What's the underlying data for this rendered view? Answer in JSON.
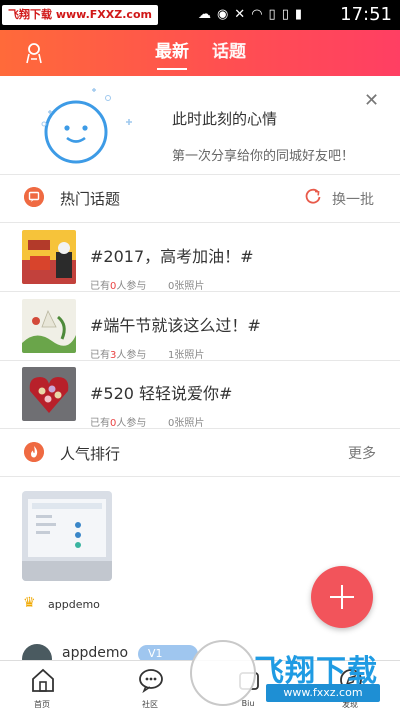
{
  "status_bar": {
    "watermark": "飞翔下载 www.FXXZ.com",
    "time": "17:51",
    "icons": [
      "cloud-icon",
      "eye-icon",
      "mute-icon",
      "wifi-icon",
      "sim-icon",
      "sim2-icon",
      "battery-icon"
    ]
  },
  "header": {
    "tabs": [
      {
        "label": "最新",
        "active": true
      },
      {
        "label": "话题",
        "active": false
      }
    ],
    "accent": "#ff5a4a"
  },
  "mood": {
    "title": "此时此刻的心情",
    "subtitle": "第一次分享给你的同城好友吧！",
    "close": "✕"
  },
  "hot_topics": {
    "title": "热门话题",
    "refresh_label": "换一批",
    "items": [
      {
        "title": "#2017，高考加油！#",
        "meta_prefix": "已有",
        "participants": "0",
        "meta_suffix": "人参与",
        "photos": "0张照片"
      },
      {
        "title": "#端午节就该这么过！#",
        "meta_prefix": "已有",
        "participants": "3",
        "meta_suffix": "人参与",
        "photos": "1张照片"
      },
      {
        "title": "#520 轻轻说爱你#",
        "meta_prefix": "已有",
        "participants": "0",
        "meta_suffix": "人参与",
        "photos": "0张照片"
      }
    ]
  },
  "ranking": {
    "title": "人气排行",
    "more": "更多",
    "items": [
      {
        "name": "appdemo"
      }
    ]
  },
  "feed": {
    "user": "appdemo",
    "badge": "V1"
  },
  "bottom_nav": {
    "items": [
      {
        "label": "首页",
        "icon": "home-icon"
      },
      {
        "label": "社区",
        "icon": "chat-icon"
      },
      {
        "label": "Biu",
        "icon": "biu-icon"
      },
      {
        "label": "发现",
        "icon": "discover-icon"
      }
    ]
  },
  "watermark": {
    "text": "飞翔下载",
    "url": "www.fxxz.com"
  }
}
